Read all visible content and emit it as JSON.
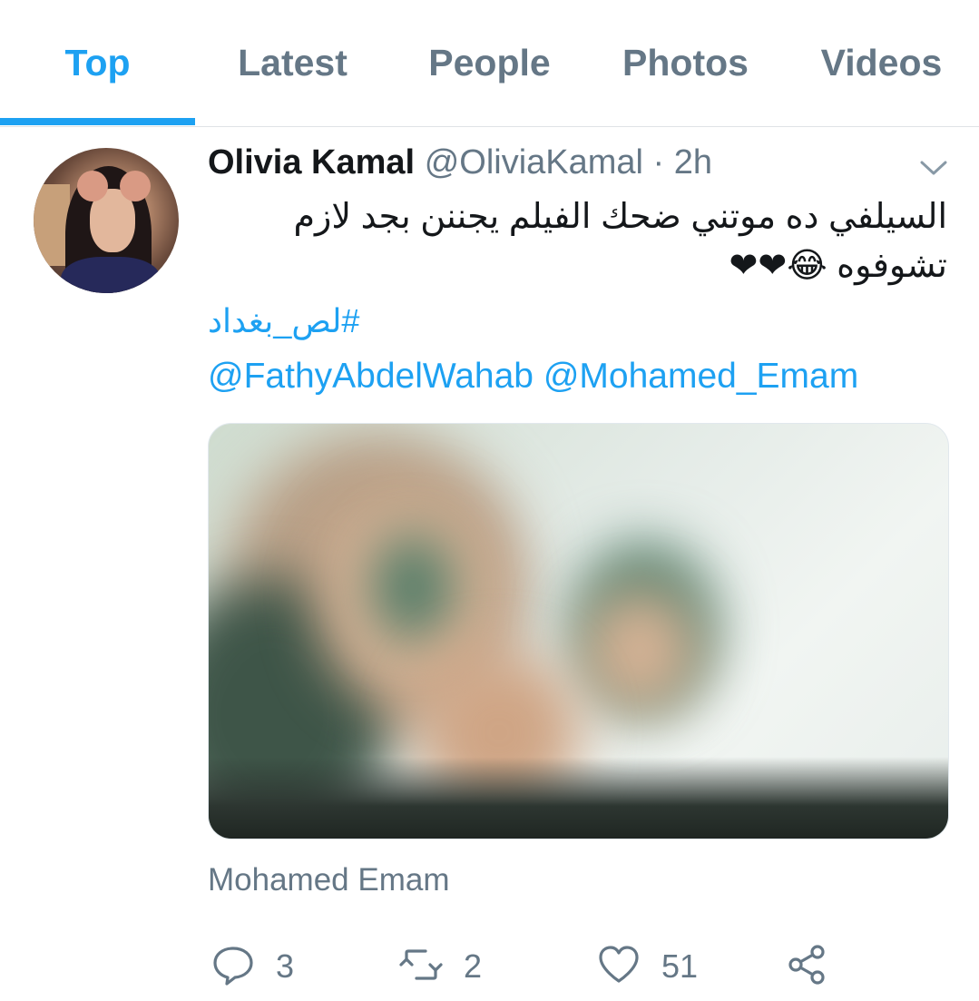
{
  "tabs": [
    {
      "label": "Top",
      "active": true
    },
    {
      "label": "Latest",
      "active": false
    },
    {
      "label": "People",
      "active": false
    },
    {
      "label": "Photos",
      "active": false
    },
    {
      "label": "Videos",
      "active": false
    }
  ],
  "colors": {
    "accent": "#1da1f2",
    "secondary_text": "#657786",
    "primary_text": "#14171a",
    "like_heart": "#e0245e"
  },
  "tweet": {
    "author_name": "Olivia Kamal",
    "handle_time": "@OliviaKamal · 2h",
    "text": "السيلفي ده موتني ضحك الفيلم يجننن بجد لازم تشوفوه 😂❤❤",
    "hashtag": "#لص_بغداد",
    "mentions": [
      "@FathyAbdelWahab",
      "@Mohamed_Emam"
    ],
    "media_attribution": "Mohamed Emam",
    "icons": {
      "menu": "chevron-down-icon",
      "reply": "reply-icon",
      "retweet": "retweet-icon",
      "like": "heart-icon",
      "share": "share-icon"
    },
    "stats": {
      "replies": "3",
      "retweets": "2",
      "likes": "51"
    }
  }
}
